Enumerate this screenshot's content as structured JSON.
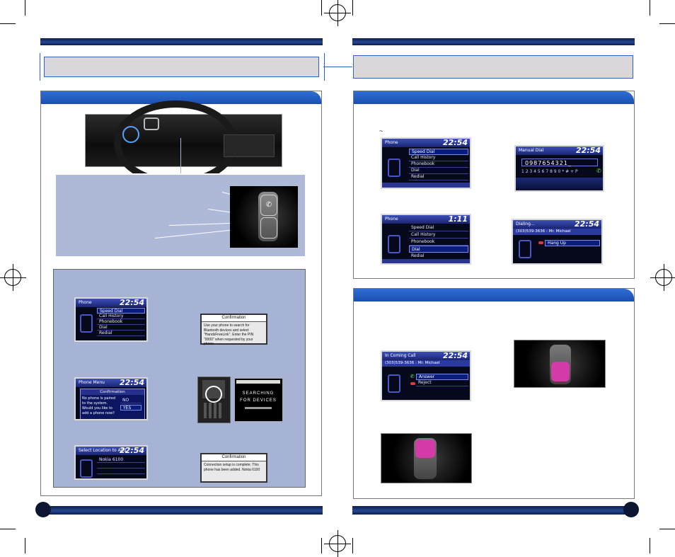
{
  "left_page": {
    "steering_hint_marker": "",
    "pairing_screens": {
      "phone_menu": {
        "title": "Phone",
        "clock": "22:54",
        "items": [
          "Speed Dial",
          "Call History",
          "Phonebook",
          "Dial",
          "Redial"
        ],
        "selected_index": 0
      },
      "confirmation_search": {
        "title": "Confirmation",
        "body": "Use your phone to search for Bluetooth devices and select \"HandsFreeLink\". Enter the PIN \"0000\" when requested by your phone."
      },
      "phone_menu_confirm": {
        "title": "Phone Menu",
        "clock": "22:54",
        "dialog_title": "Confirmation",
        "dialog_body": "No phone is paired to the system. Would you like to add a phone now?",
        "options": [
          "NO",
          "YES"
        ],
        "selected_index": 1
      },
      "searching_device": {
        "status": "SEARCHING FOR DEVICES"
      },
      "select_location": {
        "title": "Select Location to Add",
        "clock": "22:54",
        "entry": "Nokia 6100"
      },
      "connection_complete": {
        "title": "Confirmation",
        "body": "Connection setup is complete. This phone has been added. Nokia 6100"
      }
    }
  },
  "right_page": {
    "tilde": "~",
    "phone_screen_a": {
      "title": "Phone",
      "clock": "22:54",
      "items": [
        "Speed Dial",
        "Call History",
        "Phonebook",
        "Dial",
        "Redial"
      ],
      "selected_index": 0
    },
    "manual_dial": {
      "title": "Manual Dial",
      "clock": "22:54",
      "number": "0987654321_",
      "keypad": "1 2 3 4 5 6 7 8 9 0 * # + P"
    },
    "phone_screen_b": {
      "title": "Phone",
      "clock": "1:11",
      "items": [
        "Speed Dial",
        "Call History",
        "Phonebook",
        "Dial",
        "Redial"
      ],
      "selected_index": 3
    },
    "dialing": {
      "title": "Dialing...",
      "clock": "22:54",
      "caller": "(303)539-3636 : Mr. Michael",
      "action": "Hang Up"
    },
    "incoming_call": {
      "title": "In Coming Call",
      "clock": "22:54",
      "caller": "(303)539-3636 : Mr. Michael",
      "options": [
        "Answer",
        "Reject"
      ],
      "selected_index": 0
    }
  },
  "colors": {
    "header_blue": "#1f55b8",
    "bar_navy": "#0b1e4f",
    "title_gray": "#d9d7dc",
    "pairing_bg": "#a7b3d5",
    "callout_bg": "#aeb9d8",
    "screen_bg": "#06091c",
    "accent_magenta": "#d43aa8"
  }
}
